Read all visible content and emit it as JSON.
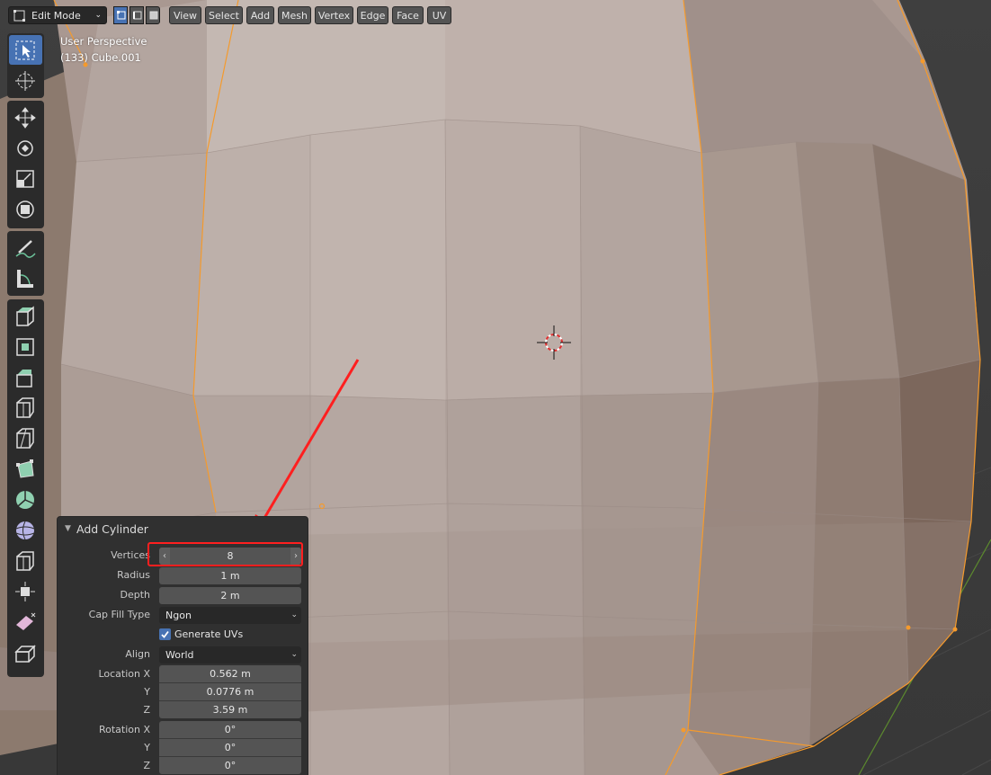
{
  "header": {
    "mode": "Edit Mode",
    "mode_icon": "edit-mode-icon",
    "select_modes": [
      "vertex-select-icon",
      "edge-select-icon",
      "face-select-icon"
    ],
    "menus": [
      "View",
      "Select",
      "Add",
      "Mesh",
      "Vertex",
      "Edge",
      "Face",
      "UV"
    ]
  },
  "overlay": {
    "perspective": "User Perspective",
    "object": "(133) Cube.001"
  },
  "toolbar": {
    "tools": [
      "select-box-icon",
      "cursor-icon",
      "move-icon",
      "rotate-icon",
      "scale-icon",
      "transform-icon",
      "annotate-icon",
      "measure-icon",
      "extrude-region-icon",
      "inset-faces-icon",
      "bevel-icon",
      "loop-cut-icon",
      "knife-icon",
      "poly-build-icon",
      "spin-icon",
      "smooth-icon",
      "edge-slide-icon",
      "shrink-fatten-icon",
      "shear-icon",
      "rip-region-icon"
    ]
  },
  "panel": {
    "title": "Add Cylinder",
    "vertices_label": "Vertices",
    "vertices_value": "8",
    "radius_label": "Radius",
    "radius_value": "1 m",
    "depth_label": "Depth",
    "depth_value": "2 m",
    "cap_fill_label": "Cap Fill Type",
    "cap_fill_value": "Ngon",
    "generate_uvs_label": "Generate UVs",
    "generate_uvs_checked": true,
    "align_label": "Align",
    "align_value": "World",
    "location_label": "Location X",
    "location_x": "0.562 m",
    "location_y": "0.0776 m",
    "location_z": "3.59 m",
    "rotation_label": "Rotation X",
    "rotation_x": "0°",
    "rotation_y": "0°",
    "rotation_z": "0°",
    "y_label": "Y",
    "z_label": "Z"
  },
  "colors": {
    "accent": "#4772b3",
    "mesh_face": "#ad9f98",
    "selected_edge": "#f59a2c",
    "annotation": "#ff1f1f"
  }
}
